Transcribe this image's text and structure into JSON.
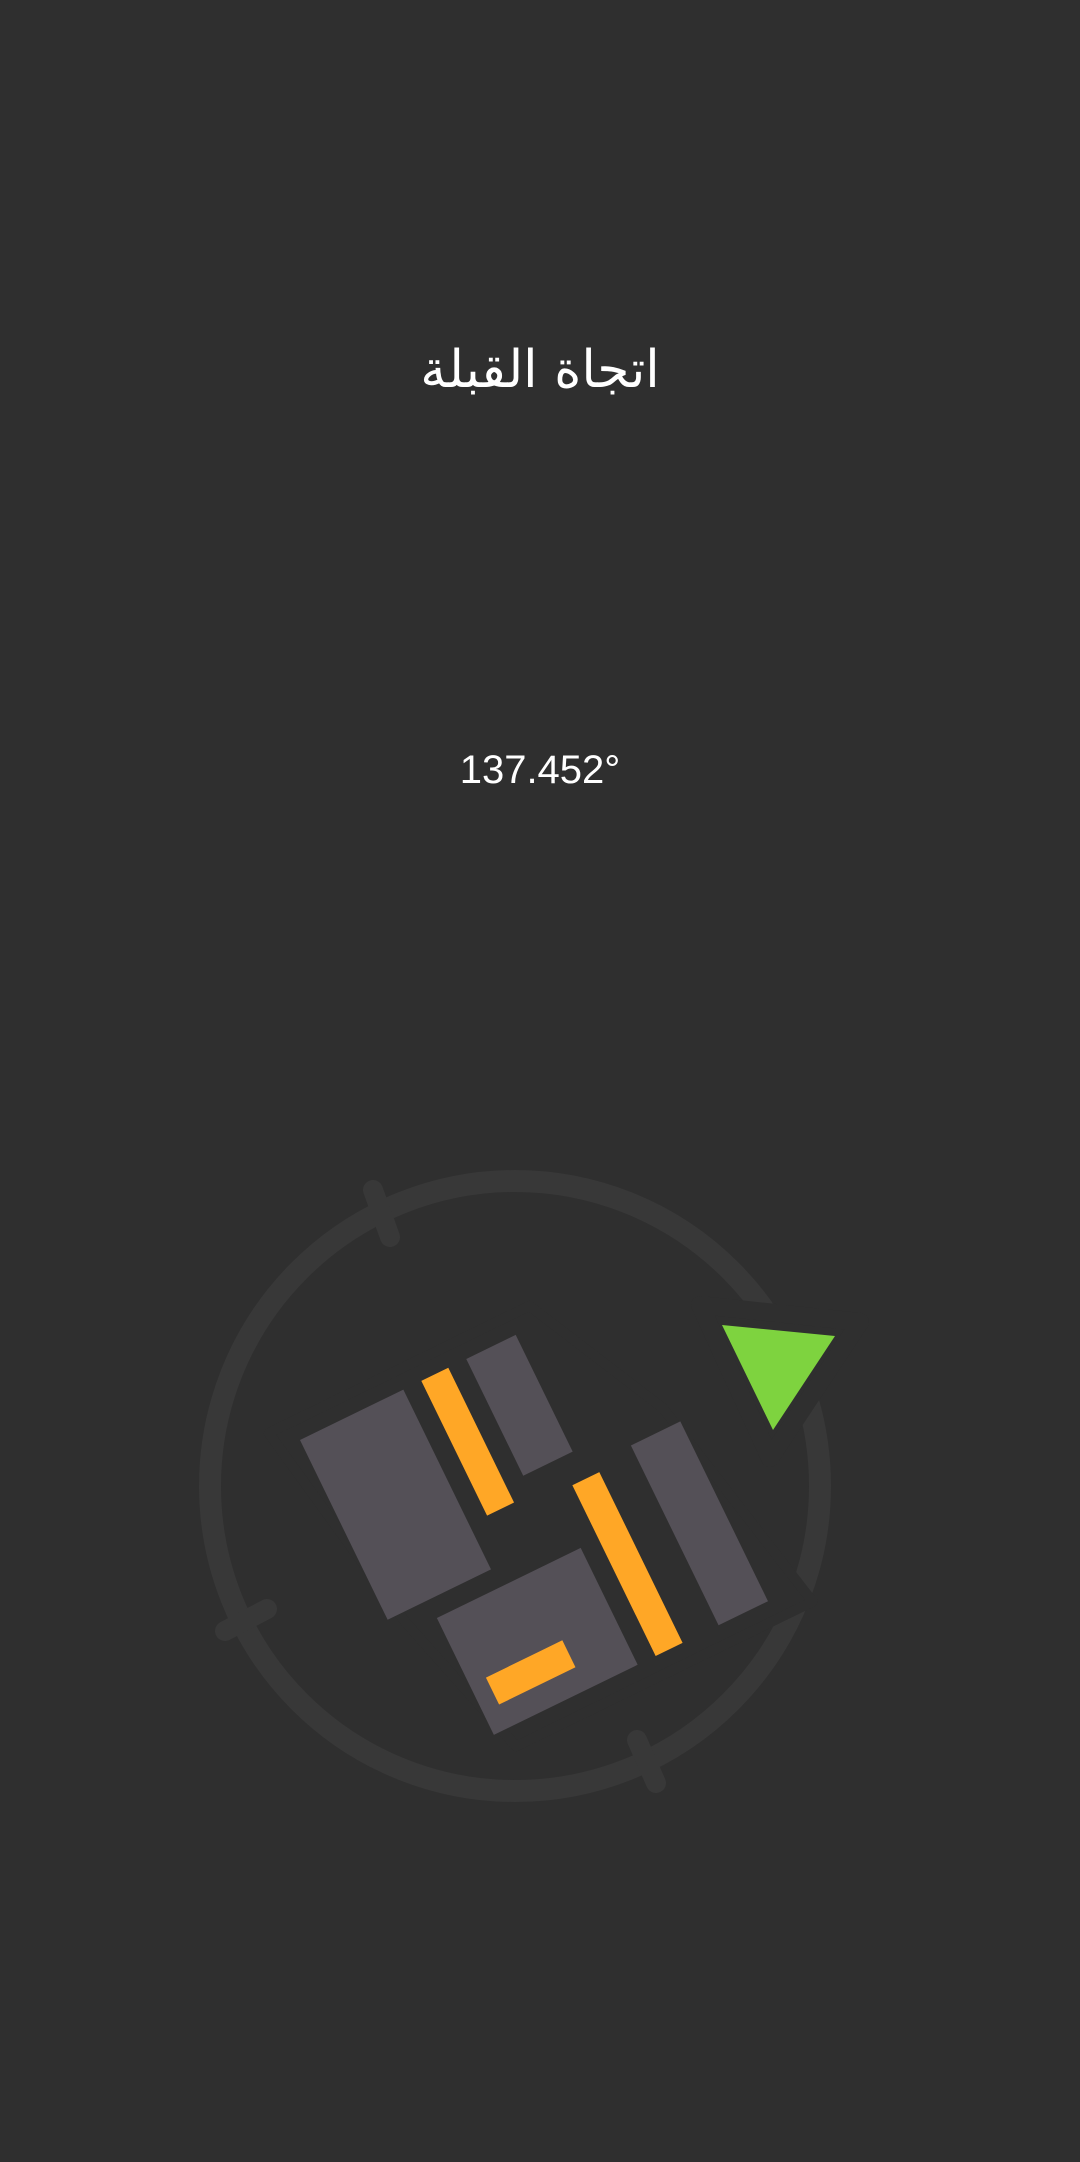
{
  "screen": {
    "title": "اتجاة القبلة",
    "bearing_text": "137.452°"
  },
  "compass": {
    "icon_name": "qibla-compass-icon",
    "pointer_icon_name": "triangle-pointer-icon",
    "colors": {
      "background": "#2f2f2f",
      "ring": "#383838",
      "outline": "#2f2f2f",
      "block_fill": "#545057",
      "stripe": "#ffa726",
      "pointer": "#7ed33f"
    }
  }
}
